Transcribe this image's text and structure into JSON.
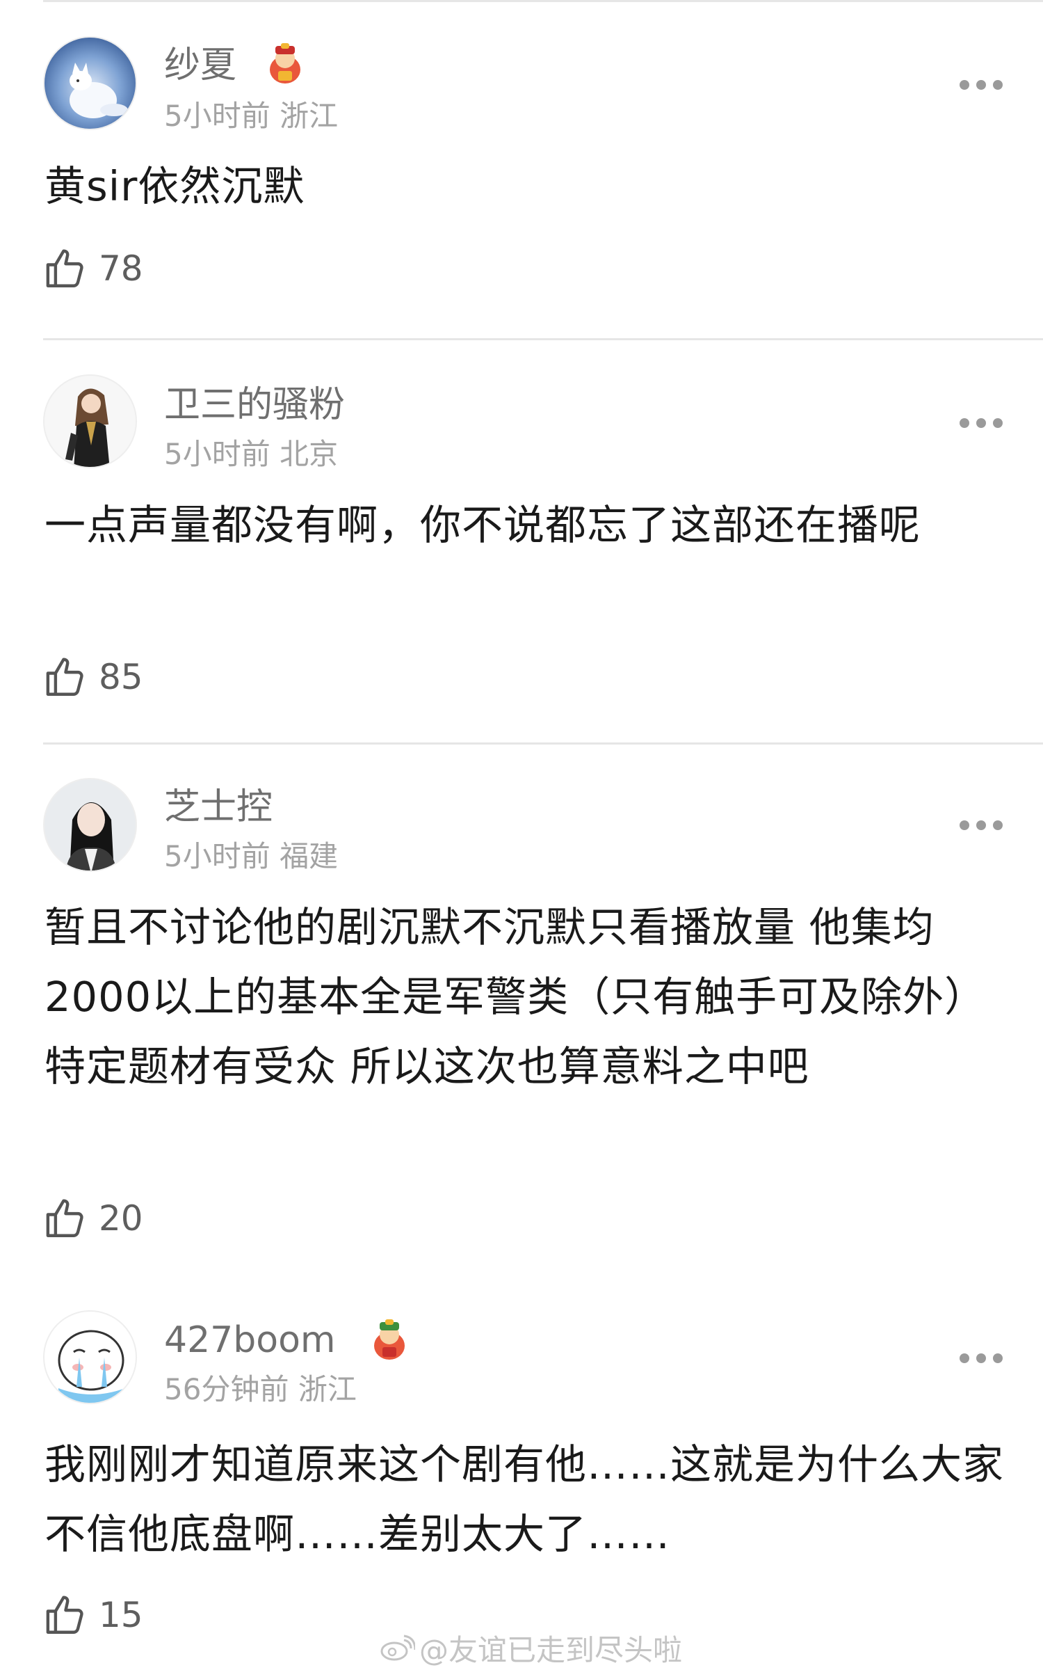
{
  "comments": [
    {
      "user": "纱夏",
      "time": "5小时前",
      "location": "浙江",
      "text": "黄sir依然沉默",
      "likes": "78",
      "avatar": "arctic-fox-avatar",
      "badge": "fortune-god-badge"
    },
    {
      "user": "卫三的骚粉",
      "time": "5小时前",
      "location": "北京",
      "text": "一点声量都没有啊，你不说都忘了这部还在播呢",
      "likes": "85",
      "avatar": "anime-character-avatar"
    },
    {
      "user": "芝士控",
      "time": "5小时前",
      "location": "福建",
      "text": "暂且不讨论他的剧沉默不沉默只看播放量 他集均2000以上的基本全是军警类（只有触手可及除外）特定题材有受众 所以这次也算意料之中吧",
      "likes": "20",
      "avatar": "woman-photo-avatar"
    },
    {
      "user": "427boom",
      "time": "56分钟前",
      "location": "浙江",
      "text": "我刚刚才知道原来这个剧有他……这就是为什么大家不信他底盘啊……差别太大了……",
      "likes": "15",
      "avatar": "crying-cartoon-avatar",
      "badge": "fortune-god-badge"
    }
  ],
  "watermark": "@友谊已走到尽头啦",
  "icons": {
    "like": "thumbs-up-icon",
    "more": "more-dots-icon",
    "watermark": "weibo-logo-icon"
  },
  "colors": {
    "text": "#1a1a1a",
    "username": "#6f6f6f",
    "meta": "#a3a3a3",
    "divider": "#e6e6e6"
  }
}
